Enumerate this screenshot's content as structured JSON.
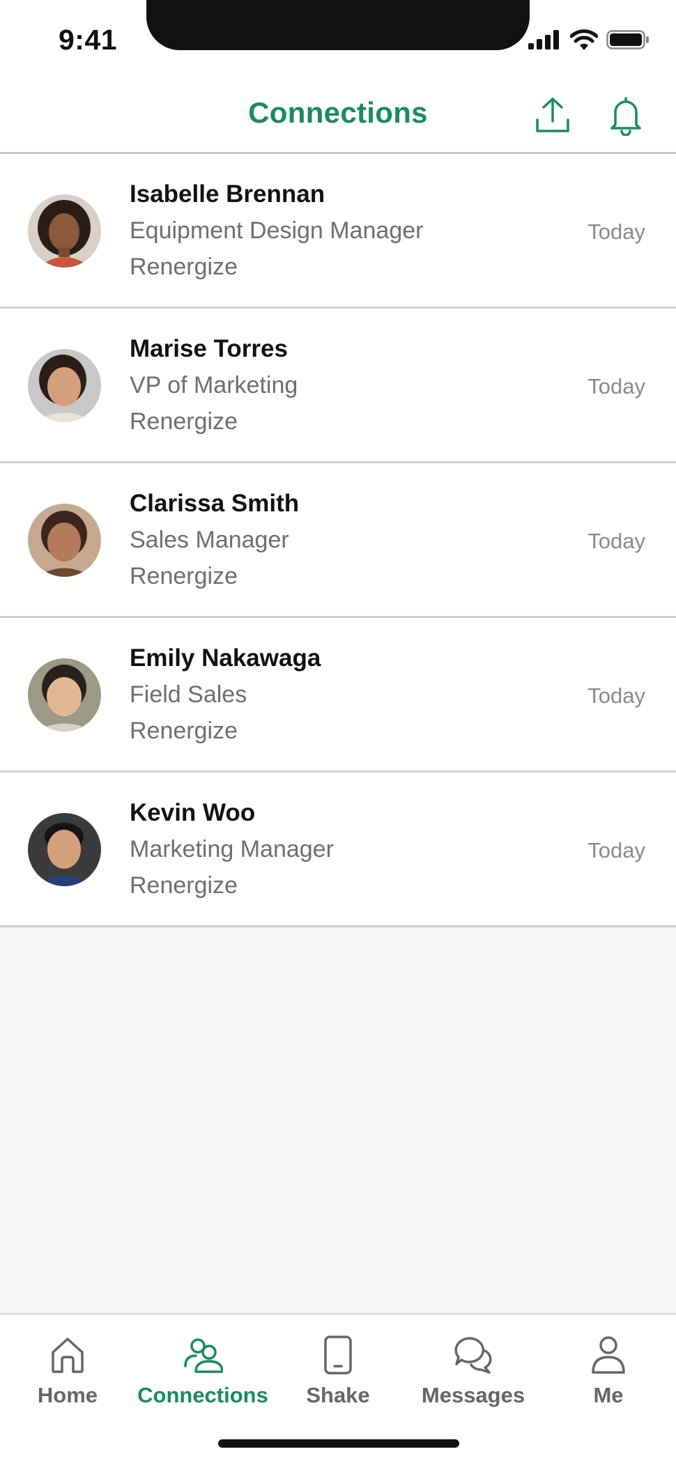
{
  "status": {
    "time": "9:41"
  },
  "header": {
    "title": "Connections",
    "upload_icon": "upload-icon",
    "bell_icon": "bell-icon"
  },
  "colors": {
    "accent": "#1a8a63",
    "secondary_text": "#6e6e6e",
    "tab_inactive": "#666666"
  },
  "connections": [
    {
      "name": "Isabelle Brennan",
      "title": "Equipment Design Manager",
      "company": "Renergize",
      "date": "Today"
    },
    {
      "name": "Marise Torres",
      "title": "VP of Marketing",
      "company": "Renergize",
      "date": "Today"
    },
    {
      "name": "Clarissa Smith",
      "title": "Sales Manager",
      "company": "Renergize",
      "date": "Today"
    },
    {
      "name": "Emily Nakawaga",
      "title": "Field Sales",
      "company": "Renergize",
      "date": "Today"
    },
    {
      "name": "Kevin Woo",
      "title": "Marketing Manager",
      "company": "Renergize",
      "date": "Today"
    }
  ],
  "tabs": [
    {
      "label": "Home",
      "icon": "home-icon",
      "active": false
    },
    {
      "label": "Connections",
      "icon": "people-icon",
      "active": true
    },
    {
      "label": "Shake",
      "icon": "phone-icon",
      "active": false
    },
    {
      "label": "Messages",
      "icon": "chat-icon",
      "active": false
    },
    {
      "label": "Me",
      "icon": "person-icon",
      "active": false
    }
  ]
}
